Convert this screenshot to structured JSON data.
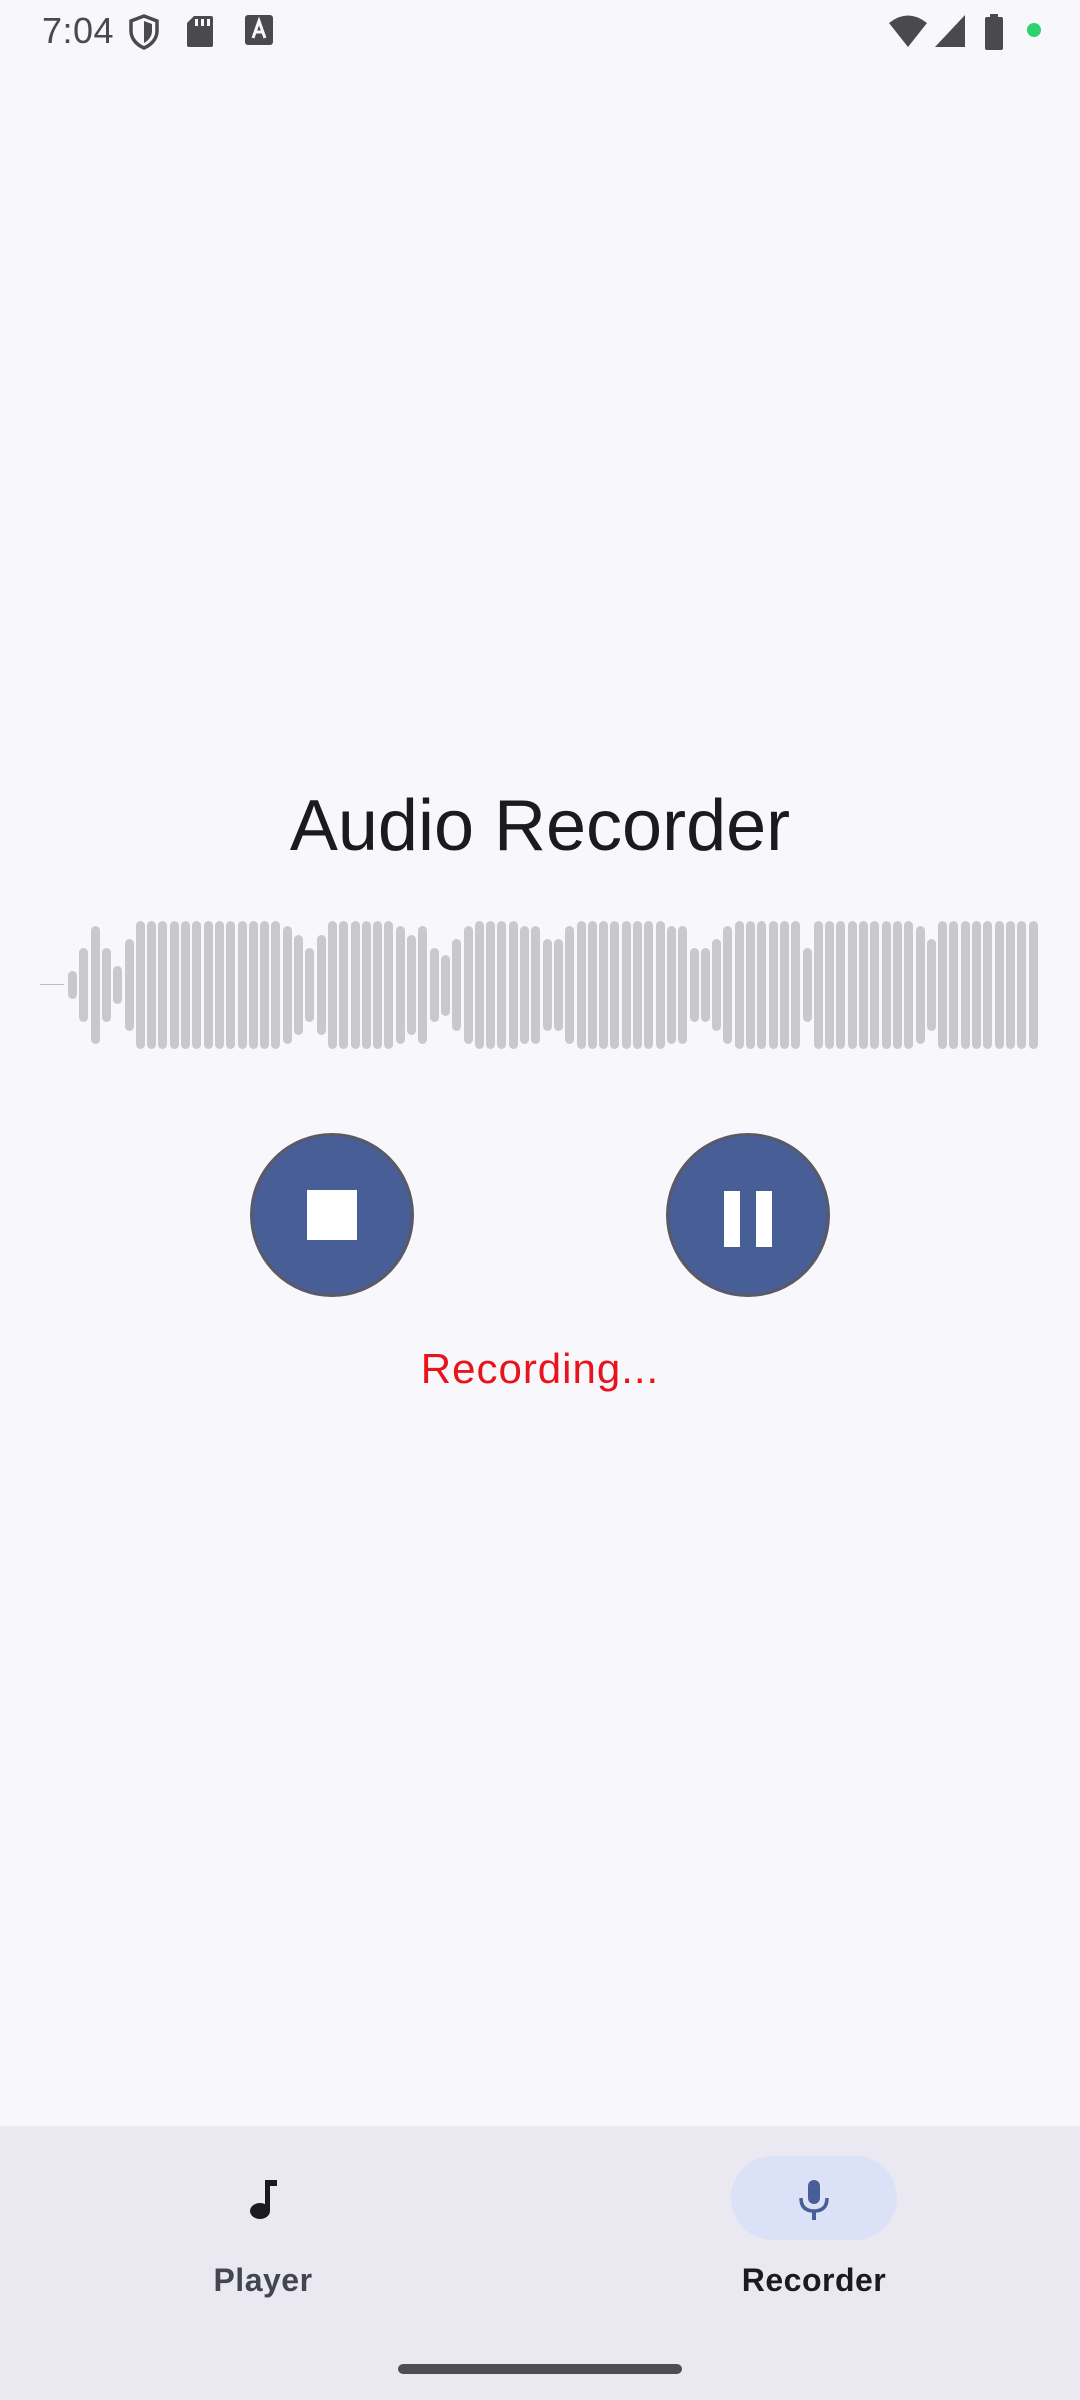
{
  "status_bar": {
    "time": "7:04",
    "icons": [
      "shield-icon",
      "sd-card-icon",
      "font-download-icon",
      "wifi-icon",
      "signal-icon",
      "battery-icon",
      "privacy-indicator-dot"
    ]
  },
  "screen": {
    "title": "Audio Recorder",
    "recording_status": "Recording...",
    "status_color": "#e8141b"
  },
  "controls": {
    "stop_icon": "stop-icon",
    "pause_icon": "pause-icon",
    "button_color": "#485e96"
  },
  "waveform": {
    "bar_color": "#c9c9cb",
    "levels": [
      0.22,
      0.58,
      0.92,
      0.58,
      0.3,
      0.72,
      1,
      1,
      1,
      1,
      1,
      1,
      1,
      1,
      1,
      1,
      1,
      1,
      1,
      0.92,
      0.78,
      0.58,
      0.78,
      1,
      1,
      1,
      1,
      1,
      1,
      0.92,
      0.78,
      0.92,
      0.58,
      0.48,
      0.72,
      0.92,
      1,
      1,
      1,
      1,
      0.92,
      0.92,
      0.72,
      0.72,
      0.92,
      1,
      1,
      1,
      1,
      1,
      1,
      1,
      1,
      0.92,
      0.92,
      0.58,
      0.58,
      0.72,
      0.92,
      1,
      1,
      1,
      1,
      1,
      1,
      0.58,
      1,
      1,
      1,
      1,
      1,
      1,
      1,
      1,
      1,
      0.92,
      0.72,
      1,
      1,
      1,
      1,
      1,
      1,
      1,
      1,
      1
    ]
  },
  "nav": {
    "items": [
      {
        "label": "Player",
        "icon": "music-note-icon",
        "active": false
      },
      {
        "label": "Recorder",
        "icon": "mic-icon",
        "active": true
      }
    ],
    "active_color": "#dbe1f6"
  }
}
